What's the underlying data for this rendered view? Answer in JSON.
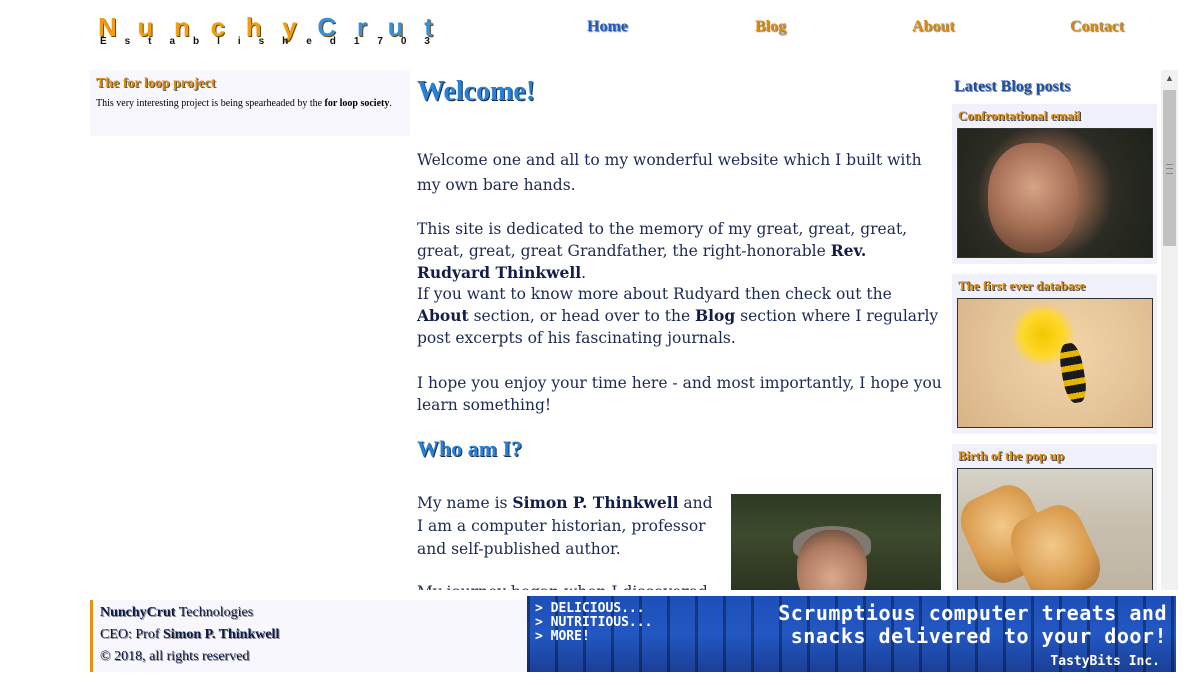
{
  "header": {
    "logo_letters": [
      "N",
      "u",
      "n",
      "c",
      "h",
      "y",
      "C",
      "r",
      "u",
      "t"
    ],
    "logo_sub_letters": [
      "E",
      "s",
      "t",
      "a",
      "b",
      "l",
      "i",
      "s",
      "h",
      "e",
      "d",
      "1",
      "7",
      "0",
      "3"
    ],
    "nav": {
      "home": "Home",
      "blog": "Blog",
      "about": "About",
      "contact": "Contact"
    }
  },
  "left_sidebar": {
    "title": "The for loop project",
    "text_before": "This very interesting project is being spearheaded by the ",
    "text_bold": "for loop society",
    "text_after": "."
  },
  "main": {
    "heading": "Welcome!",
    "p1": "Welcome one and all to my wonderful website which I built with my own bare hands.",
    "p2_before": "This site is dedicated to the memory of my great, great, great, great, great, great Grandfather, the right-honorable ",
    "p2_bold": "Rev. Rudyard Thinkwell",
    "p2_after": ".",
    "p3_a": "If you want to know more about Rudyard then check out the ",
    "p3_b": "About",
    "p3_c": " section, or head over to the ",
    "p3_d": "Blog",
    "p3_e": " section where I regularly post excerpts of his fascinating journals.",
    "p4": "I hope you enjoy your time here - and most importantly, I hope you learn something!",
    "heading2": "Who am I?",
    "p5_a": "My name is ",
    "p5_b": "Simon P. Thinkwell",
    "p5_c": " and I am a computer historian, professor and self-published author.",
    "p6": "My journey began when I discovered the"
  },
  "right_sidebar": {
    "title": "Latest Blog posts",
    "posts": [
      {
        "title": "Confrontational email"
      },
      {
        "title": "The first ever database"
      },
      {
        "title": "Birth of the pop up"
      }
    ]
  },
  "footer": {
    "company_bold": "NunchyCrut",
    "company_rest": " Technologies",
    "ceo_prefix": "CEO: Prof ",
    "ceo_name": "Simon P. Thinkwell",
    "copyright": "© 2018, all rights reserved"
  },
  "ad": {
    "line1": "> DELICIOUS...",
    "line2": "> NUTRITIOUS...",
    "line3": "> MORE!",
    "headline1": "Scrumptious computer treats and",
    "headline2": "snacks delivered to your door!",
    "brand": "TastyBits Inc."
  }
}
